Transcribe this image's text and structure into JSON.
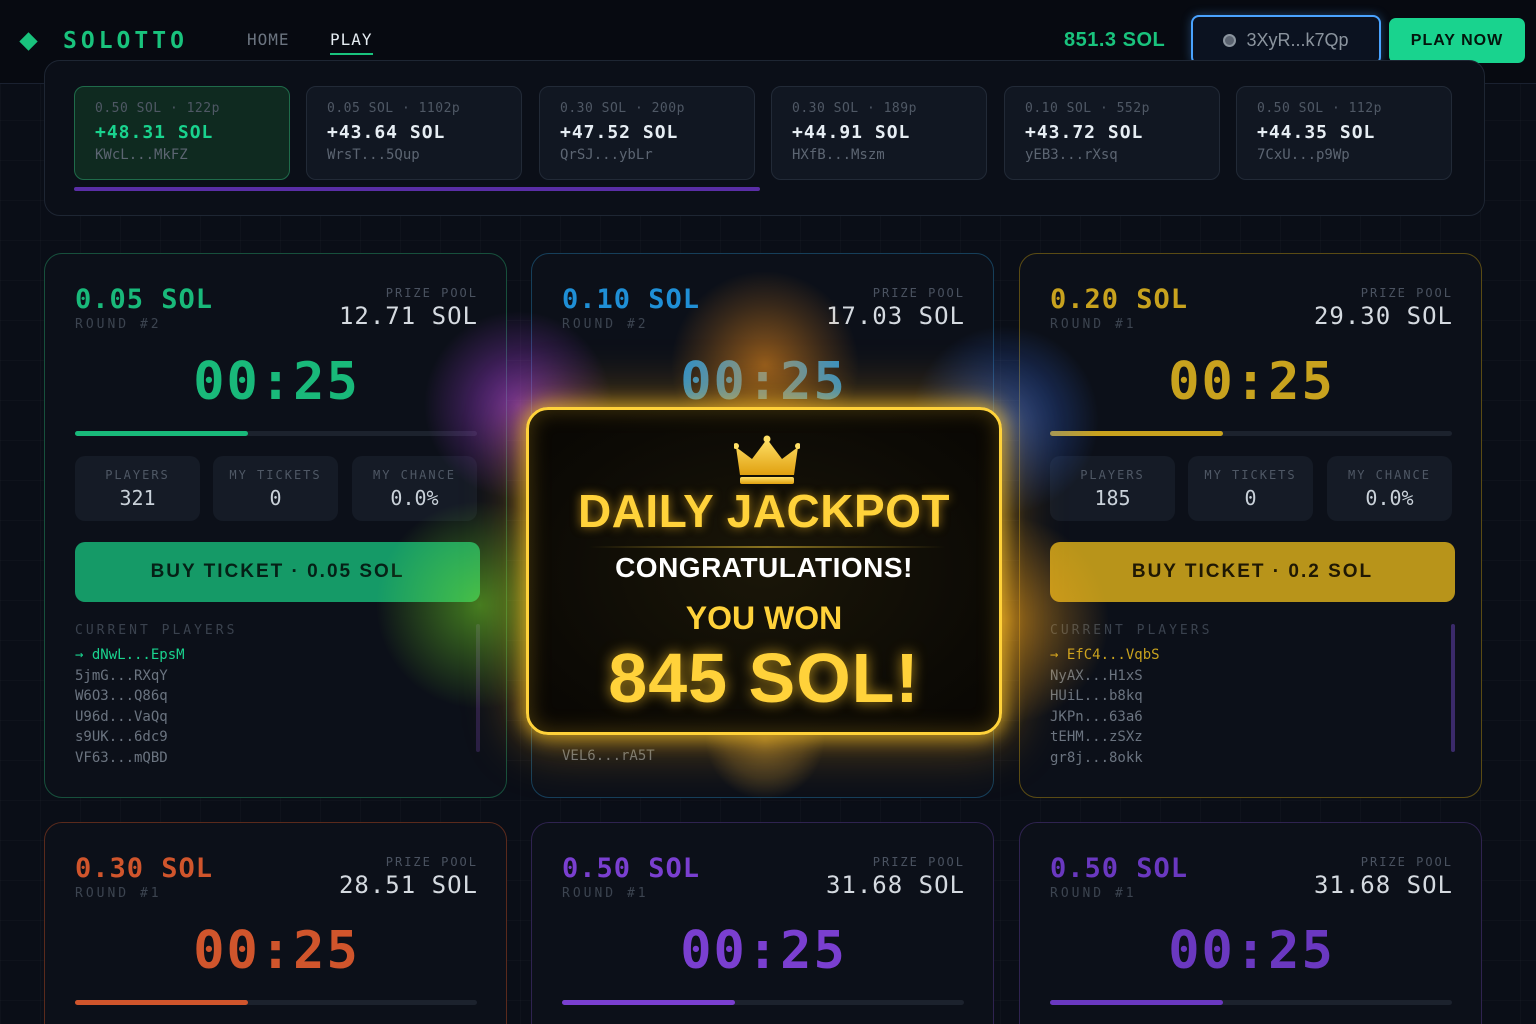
{
  "nav": {
    "logo": "SOLOTTO",
    "links": [
      "HOME",
      "PLAY"
    ],
    "balance": "851.3 SOL",
    "wallet": "3XyR...k7Qp",
    "play_now": "PLAY NOW"
  },
  "winners": [
    {
      "meta": "0.50 SOL · 122p",
      "amount": "+48.31 SOL",
      "address": "KWcL...MkFZ"
    },
    {
      "meta": "0.05 SOL · 1102p",
      "amount": "+43.64 SOL",
      "address": "WrsT...5Qup"
    },
    {
      "meta": "0.30 SOL · 200p",
      "amount": "+47.52 SOL",
      "address": "QrSJ...ybLr"
    },
    {
      "meta": "0.30 SOL · 189p",
      "amount": "+44.91 SOL",
      "address": "HXfB...Mszm"
    },
    {
      "meta": "0.10 SOL · 552p",
      "amount": "+43.72 SOL",
      "address": "yEB3...rXsq"
    },
    {
      "meta": "0.50 SOL · 112p",
      "amount": "+44.35 SOL",
      "address": "7CxU...p9Wp"
    }
  ],
  "labels": {
    "prize_pool": "PRIZE POOL",
    "players": "PLAYERS",
    "my_tickets": "MY TICKETS",
    "my_chance": "MY CHANCE",
    "current_players": "CURRENT PLAYERS"
  },
  "rounds": [
    {
      "amount": "0.05 SOL",
      "round": "ROUND #2",
      "pool": "12.71 SOL",
      "timer": "00:25",
      "progress": 0.43,
      "players": "321",
      "tickets": "0",
      "chance": "0.0%",
      "buy_label": "BUY TICKET · 0.05 SOL",
      "player_list": [
        "→ dNwL...EpsM",
        "5jmG...RXqY",
        "W6O3...Q86q",
        "U96d...VaQq",
        "s9UK...6dc9",
        "VF63...mQBD"
      ]
    },
    {
      "amount": "0.10 SOL",
      "round": "ROUND #2",
      "pool": "17.03 SOL",
      "timer": "00:25",
      "progress": 0.43,
      "players": "",
      "tickets": "",
      "chance": "",
      "buy_label": "",
      "player_list": [
        "VEL6...rA5T"
      ]
    },
    {
      "amount": "0.20 SOL",
      "round": "ROUND #1",
      "pool": "29.30 SOL",
      "timer": "00:25",
      "progress": 0.43,
      "players": "185",
      "tickets": "0",
      "chance": "0.0%",
      "buy_label": "BUY TICKET · 0.2 SOL",
      "player_list": [
        "→ EfC4...VqbS",
        "NyAX...H1xS",
        "HUiL...b8kq",
        "JKPn...63a6",
        "tEHM...zSXz",
        "gr8j...8okk"
      ]
    },
    {
      "amount": "0.30 SOL",
      "round": "ROUND #1",
      "pool": "28.51 SOL",
      "timer": "00:25",
      "progress": 0.43
    },
    {
      "amount": "0.50 SOL",
      "round": "ROUND #1",
      "pool": "31.68 SOL",
      "timer": "00:25",
      "progress": 0.43
    },
    {
      "amount": "0.50 SOL",
      "round": "ROUND #1",
      "pool": "31.68 SOL",
      "timer": "00:25",
      "progress": 0.43
    }
  ],
  "colors": {
    "green": "#19b97a",
    "blue": "#1f8fd6",
    "gold": "#c8a21e",
    "orange": "#d0552c",
    "purple": "#7a3fd0",
    "purple2": "#6a38c0"
  },
  "jackpot": {
    "icon": "crown-icon",
    "title": "DAILY JACKPOT",
    "subtitle": "CONGRATULATIONS!",
    "won_label": "YOU WON",
    "amount": "845 SOL!"
  }
}
